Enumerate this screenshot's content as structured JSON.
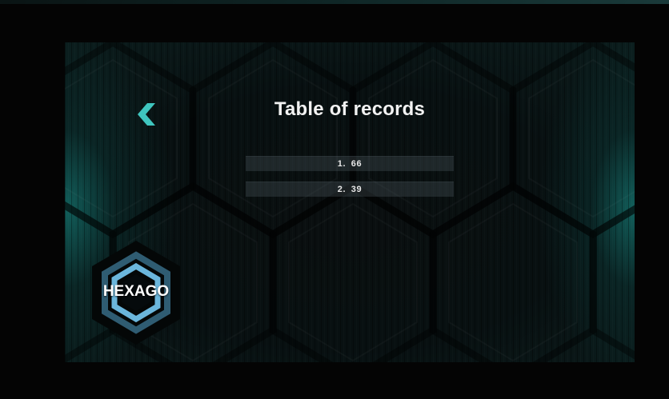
{
  "screen": {
    "title": "Table of records"
  },
  "records": [
    {
      "rank": "1.",
      "score": "66"
    },
    {
      "rank": "2.",
      "score": "39"
    }
  ],
  "logo": {
    "text": "HEXAGO"
  },
  "icons": {
    "back": "chevron-left-icon"
  },
  "colors": {
    "accent": "#3fc6bf",
    "logo_ring": "#5ea9d0",
    "background": "#081011"
  }
}
